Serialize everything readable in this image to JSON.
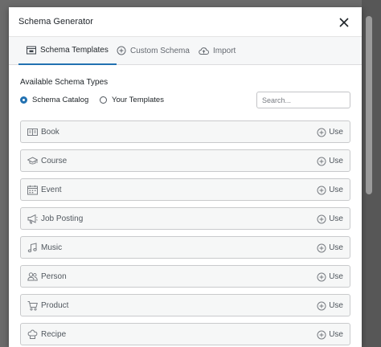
{
  "modal": {
    "title": "Schema Generator"
  },
  "tabs": [
    {
      "label": "Schema Templates",
      "icon": "template-icon",
      "active": true
    },
    {
      "label": "Custom Schema",
      "icon": "plus-circle-icon",
      "active": false
    },
    {
      "label": "Import",
      "icon": "cloud-upload-icon",
      "active": false
    }
  ],
  "section": {
    "title": "Available Schema Types"
  },
  "radios": [
    {
      "label": "Schema Catalog",
      "checked": true
    },
    {
      "label": "Your Templates",
      "checked": false
    }
  ],
  "search": {
    "placeholder": "Search...",
    "value": ""
  },
  "schema_types": [
    {
      "label": "Book",
      "icon": "book-icon",
      "action": "Use"
    },
    {
      "label": "Course",
      "icon": "graduation-cap-icon",
      "action": "Use"
    },
    {
      "label": "Event",
      "icon": "calendar-icon",
      "action": "Use"
    },
    {
      "label": "Job Posting",
      "icon": "megaphone-icon",
      "action": "Use"
    },
    {
      "label": "Music",
      "icon": "music-note-icon",
      "action": "Use"
    },
    {
      "label": "Person",
      "icon": "people-icon",
      "action": "Use"
    },
    {
      "label": "Product",
      "icon": "cart-icon",
      "action": "Use"
    },
    {
      "label": "Recipe",
      "icon": "chef-hat-icon",
      "action": "Use"
    }
  ],
  "colors": {
    "accent": "#2271b1",
    "overlay": "#6b6b6b",
    "row_background": "#f6f7f7",
    "row_border": "#c9cacc"
  }
}
